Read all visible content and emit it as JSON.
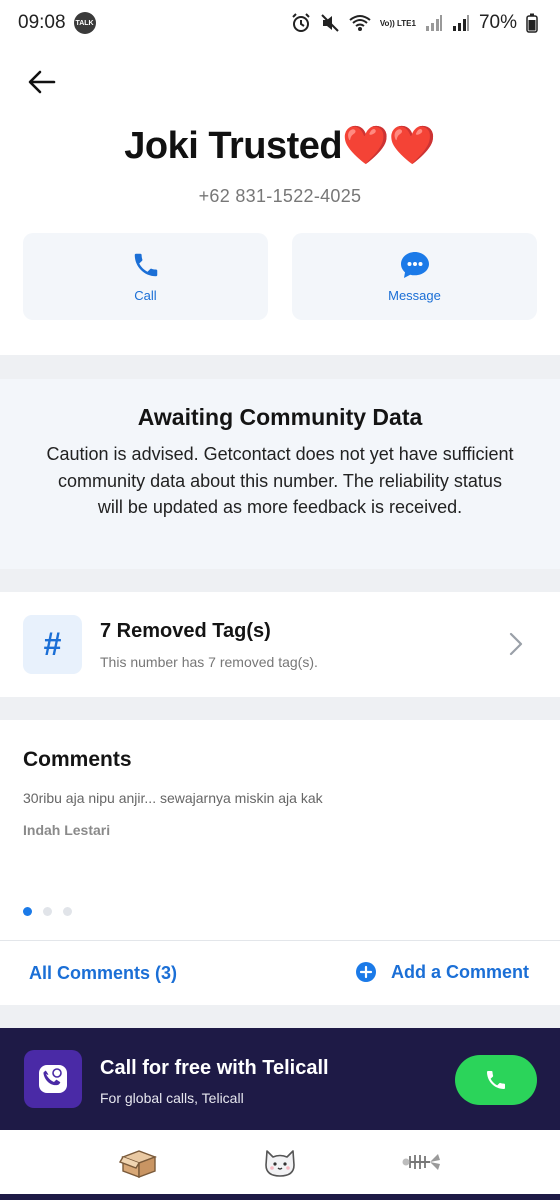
{
  "status_bar": {
    "time": "09:08",
    "talk_badge": "TALK",
    "network": "Vo)) LTE1",
    "battery": "70%"
  },
  "contact": {
    "name": "Joki Trusted",
    "name_emoji": "❤️❤️",
    "phone": "+62 831-1522-4025"
  },
  "actions": {
    "call_label": "Call",
    "message_label": "Message"
  },
  "community": {
    "title": "Awaiting Community Data",
    "description": "Caution is advised. Getcontact does not yet have sufficient community data about this number. The reliability status will be updated as more feedback is received."
  },
  "tags": {
    "icon_symbol": "#",
    "title": "7 Removed Tag(s)",
    "subtitle": "This number has 7 removed tag(s)."
  },
  "comments": {
    "heading": "Comments",
    "items": [
      {
        "text": "30ribu aja nipu anjir... sewajarnya miskin aja kak",
        "author": "Indah Lestari"
      }
    ],
    "pages": 3,
    "active_page": 1,
    "all_comments_label": "All Comments (3)",
    "add_comment_label": "Add a Comment"
  },
  "promo": {
    "title": "Call for free with Telicall",
    "subtitle": "For global calls, Telicall"
  },
  "bottom_nav": {
    "items": [
      "box-icon",
      "cat-face-icon",
      "fish-bone-icon"
    ]
  },
  "colors": {
    "accent_blue": "#1b6fd6",
    "promo_bg": "#1e1a46",
    "call_green": "#2bd45a",
    "hearts": "#ff2d55"
  }
}
